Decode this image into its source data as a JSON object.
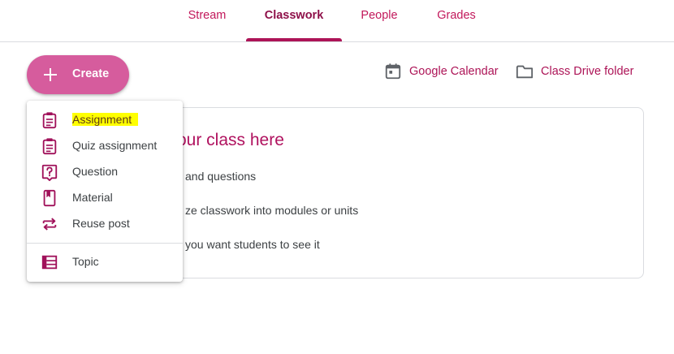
{
  "tabs": [
    {
      "label": "Stream"
    },
    {
      "label": "Classwork",
      "active": true
    },
    {
      "label": "People"
    },
    {
      "label": "Grades"
    }
  ],
  "create_button": {
    "label": "Create",
    "icon": "plus-icon"
  },
  "toolbar": {
    "calendar": {
      "label": "Google Calendar",
      "icon": "calendar-icon"
    },
    "drive": {
      "label": "Class Drive folder",
      "icon": "folder-icon"
    }
  },
  "card": {
    "title": "our class here",
    "lines": [
      "and questions",
      "ze classwork into modules or units",
      "you want students to see it"
    ]
  },
  "menu": {
    "items": [
      {
        "label": "Assignment",
        "icon": "assignment-icon",
        "highlighted": true
      },
      {
        "label": "Quiz assignment",
        "icon": "quiz-assignment-icon"
      },
      {
        "label": "Question",
        "icon": "question-icon"
      },
      {
        "label": "Material",
        "icon": "material-icon"
      },
      {
        "label": "Reuse post",
        "icon": "reuse-post-icon"
      }
    ],
    "topic": {
      "label": "Topic",
      "icon": "topic-icon"
    }
  },
  "colors": {
    "accent": "#ad1457",
    "tab_text": "#c2185b",
    "create_button": "#d65c9d",
    "highlight": "#ffff00"
  }
}
